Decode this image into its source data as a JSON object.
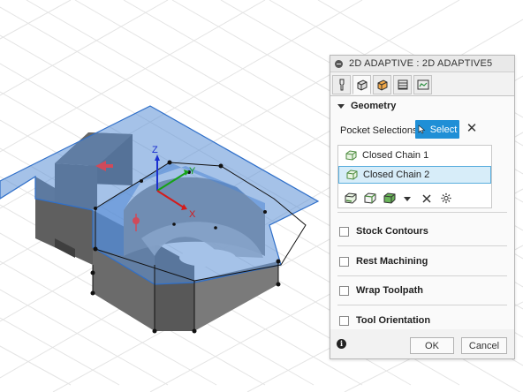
{
  "viewport": {
    "axis_z": "Z",
    "axis_y": "Y",
    "axis_x": "X"
  },
  "panel": {
    "title": "2D ADAPTIVE : 2D ADAPTIVE5",
    "tabs": [
      {
        "icon": "tool-icon",
        "active": false
      },
      {
        "icon": "geometry-icon",
        "active": true
      },
      {
        "icon": "heights-icon",
        "active": false
      },
      {
        "icon": "passes-icon",
        "active": false
      },
      {
        "icon": "linking-icon",
        "active": false
      }
    ],
    "geometry": {
      "section_title": "Geometry",
      "pocket_selections_label": "Pocket Selections",
      "select_button_label": "Select",
      "chains": [
        {
          "label": "Closed Chain 1",
          "selected": false
        },
        {
          "label": "Closed Chain 2",
          "selected": true
        }
      ]
    },
    "sections": [
      {
        "label": "Stock Contours"
      },
      {
        "label": "Rest Machining"
      },
      {
        "label": "Wrap Toolpath"
      },
      {
        "label": "Tool Orientation"
      }
    ],
    "footer": {
      "ok_label": "OK",
      "cancel_label": "Cancel"
    }
  },
  "colors": {
    "accent": "#1f8fd6",
    "selection_fill": "#d7edf9",
    "highlight_surface": "#5b8fd6",
    "part_body": "#6f6f6f"
  }
}
